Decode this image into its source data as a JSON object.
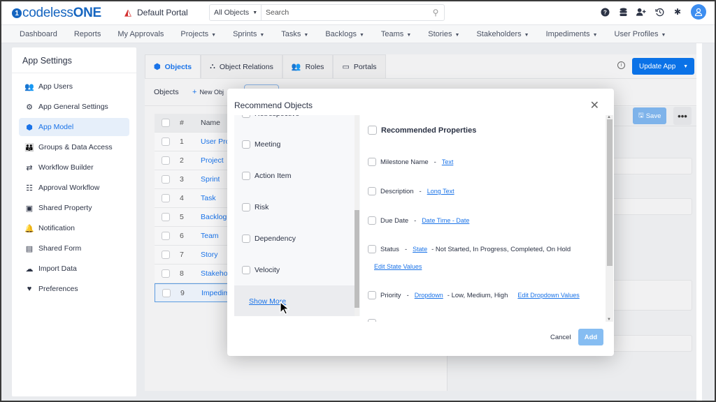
{
  "header": {
    "logo_prefix": "codeless",
    "logo_suffix": "ONE",
    "portal_name": "Default Portal",
    "search_scope": "All Objects",
    "search_placeholder": "Search",
    "icons": [
      "help-icon",
      "database-icon",
      "add-user-icon",
      "history-icon",
      "gear-icon",
      "user-avatar-icon"
    ]
  },
  "nav": {
    "items": [
      {
        "label": "Dashboard",
        "dropdown": false
      },
      {
        "label": "Reports",
        "dropdown": false
      },
      {
        "label": "My Approvals",
        "dropdown": false
      },
      {
        "label": "Projects",
        "dropdown": true
      },
      {
        "label": "Sprints",
        "dropdown": true
      },
      {
        "label": "Tasks",
        "dropdown": true
      },
      {
        "label": "Backlogs",
        "dropdown": true
      },
      {
        "label": "Teams",
        "dropdown": true
      },
      {
        "label": "Stories",
        "dropdown": true
      },
      {
        "label": "Stakeholders",
        "dropdown": true
      },
      {
        "label": "Impediments",
        "dropdown": true
      },
      {
        "label": "User Profiles",
        "dropdown": true
      }
    ]
  },
  "sidebar": {
    "title": "App Settings",
    "items": [
      {
        "label": "App Users",
        "icon": "users-icon",
        "active": false
      },
      {
        "label": "App General Settings",
        "icon": "gear-icon",
        "active": false
      },
      {
        "label": "App Model",
        "icon": "cube-icon",
        "active": true
      },
      {
        "label": "Groups & Data Access",
        "icon": "groups-icon",
        "active": false
      },
      {
        "label": "Workflow Builder",
        "icon": "arrows-icon",
        "active": false
      },
      {
        "label": "Approval Workflow",
        "icon": "checklist-icon",
        "active": false
      },
      {
        "label": "Shared Property",
        "icon": "inbox-icon",
        "active": false
      },
      {
        "label": "Notification",
        "icon": "bell-icon",
        "active": false
      },
      {
        "label": "Shared Form",
        "icon": "form-icon",
        "active": false
      },
      {
        "label": "Import Data",
        "icon": "cloud-upload-icon",
        "active": false
      },
      {
        "label": "Preferences",
        "icon": "hand-heart-icon",
        "active": false
      }
    ]
  },
  "main": {
    "tabs": [
      {
        "label": "Objects",
        "icon": "cube-icon",
        "active": true
      },
      {
        "label": "Object Relations",
        "icon": "relations-icon",
        "active": false
      },
      {
        "label": "Roles",
        "icon": "users-icon",
        "active": false
      },
      {
        "label": "Portals",
        "icon": "laptop-icon",
        "active": false
      }
    ],
    "update_button": "Update App",
    "objects_label": "Objects",
    "new_object_label": "New Obj",
    "table": {
      "headers": [
        "#",
        "Name"
      ],
      "rows": [
        {
          "num": "1",
          "name": "User Pro"
        },
        {
          "num": "2",
          "name": "Project"
        },
        {
          "num": "3",
          "name": "Sprint"
        },
        {
          "num": "4",
          "name": "Task"
        },
        {
          "num": "5",
          "name": "Backlog"
        },
        {
          "num": "6",
          "name": "Team"
        },
        {
          "num": "7",
          "name": "Story"
        },
        {
          "num": "8",
          "name": "Stakeho"
        },
        {
          "num": "9",
          "name": "Impedim",
          "selected": true
        }
      ]
    },
    "save_button": "Save",
    "more_button": "•••"
  },
  "modal": {
    "title": "Recommend Objects",
    "objects": [
      {
        "label": "Retrospective",
        "partial": true
      },
      {
        "label": "Meeting"
      },
      {
        "label": "Action Item"
      },
      {
        "label": "Risk"
      },
      {
        "label": "Dependency"
      },
      {
        "label": "Velocity"
      }
    ],
    "show_more": "Show More",
    "properties_header": "Recommended Properties",
    "properties": [
      {
        "name": "Milestone Name",
        "type": "Text",
        "values": "",
        "edit": ""
      },
      {
        "name": "Description",
        "type": "Long Text",
        "values": "",
        "edit": ""
      },
      {
        "name": "Due Date",
        "type": "Date Time - Date",
        "values": "",
        "edit": ""
      },
      {
        "name": "Status",
        "type": "State",
        "values": "- Not Started, In Progress, Completed, On Hold",
        "edit": "Edit State Values"
      },
      {
        "name": "Priority",
        "type": "Dropdown",
        "values": "- Low, Medium, High",
        "edit": "Edit Dropdown Values"
      }
    ],
    "cancel": "Cancel",
    "add": "Add"
  }
}
